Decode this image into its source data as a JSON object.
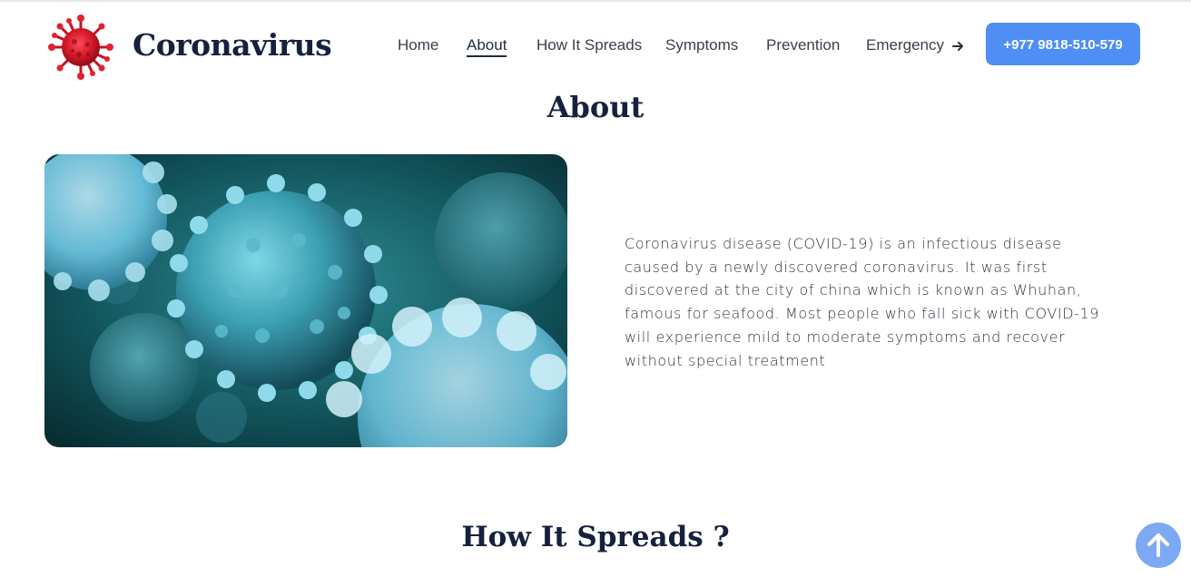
{
  "brand": {
    "name": "Coronavirus",
    "logo_icon": "virus-icon",
    "logo_color": "#d91a2a"
  },
  "nav": {
    "items": [
      {
        "label": "Home",
        "active": false
      },
      {
        "label": "About",
        "active": true
      },
      {
        "label": "How It Spreads",
        "active": false
      },
      {
        "label": "Symptoms",
        "active": false
      },
      {
        "label": "Prevention",
        "active": false
      },
      {
        "label": "Emergency",
        "active": false,
        "icon": "arrow-right-icon"
      }
    ],
    "phone_button": "+977 9818-510-579"
  },
  "about": {
    "title": "About",
    "image_description_icon": "coronavirus-image",
    "paragraph_lines": [
      "Coronavirus disease (COVID-19) is an infectious disease",
      "caused by a newly discovered coronavirus. It was first",
      "discovered at the city of china which is known as Whuhan,",
      "famous for seafood. Most people who fall sick with COVID-19",
      "will experience mild to moderate symptoms and recover",
      "without special treatment"
    ]
  },
  "next_section": {
    "title": "How It Spreads ?"
  },
  "scroll_top": {
    "icon": "arrow-up-icon"
  },
  "colors": {
    "accent": "#4f8ef4",
    "scroll_button": "#7da8f2",
    "heading": "#16213e"
  }
}
